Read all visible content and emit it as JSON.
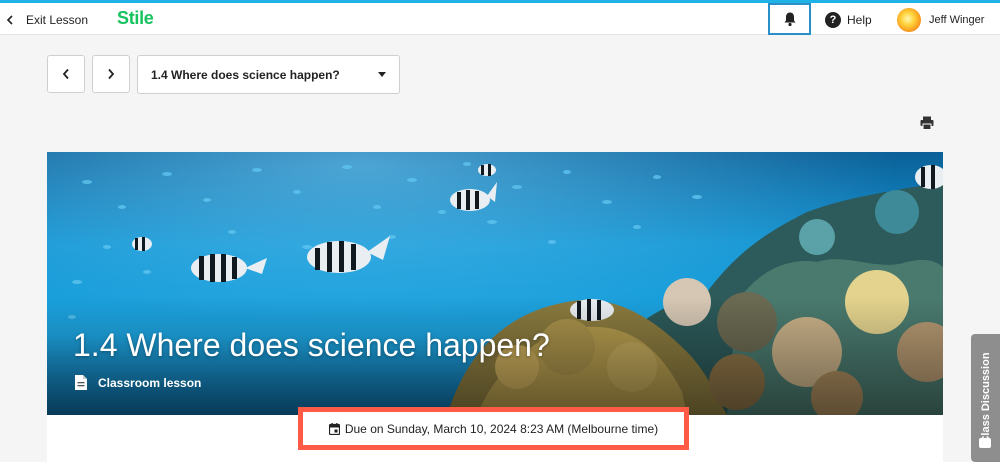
{
  "header": {
    "exit_label": "Exit Lesson",
    "logo": "Stile",
    "help_label": "Help",
    "user_name": "Jeff Winger"
  },
  "lesson_nav": {
    "selected_lesson": "1.4 Where does science happen?"
  },
  "hero": {
    "title": "1.4 Where does science happen?",
    "lesson_type": "Classroom lesson"
  },
  "due": {
    "text": "Due on Sunday, March 10, 2024 8:23 AM (Melbourne time)"
  },
  "sidebar": {
    "discussion_label": "Class Discussion"
  },
  "icons": {
    "exit": "chevron-left-icon",
    "bell": "bell-icon",
    "help": "question-circle-icon",
    "print": "printer-icon",
    "document": "document-icon",
    "calendar": "calendar-icon",
    "chat": "chat-icon"
  },
  "colors": {
    "accent": "#1fb2e6",
    "logo": "#16c25e",
    "due_highlight": "#ff5a45",
    "bell_focus": "#2a8fc7"
  }
}
